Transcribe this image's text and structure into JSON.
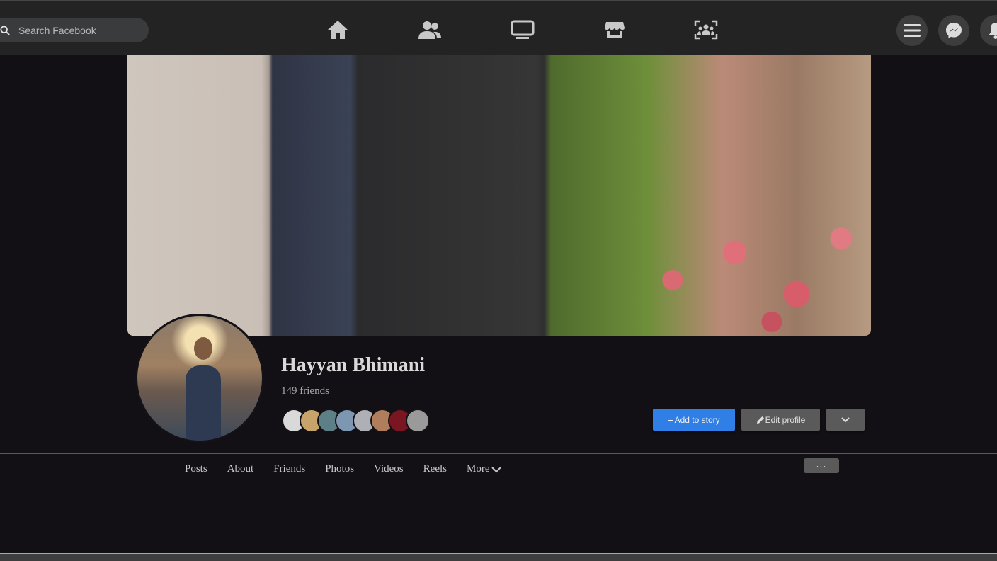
{
  "search": {
    "placeholder": "Search Facebook"
  },
  "nav": {
    "icons": [
      "home-icon",
      "friends-icon",
      "watch-icon",
      "marketplace-icon",
      "groups-icon"
    ],
    "right_buttons": [
      "menu-icon",
      "messenger-icon",
      "notifications-icon"
    ]
  },
  "profile": {
    "name": "Hayyan Bhimani",
    "friends_count": "149 friends"
  },
  "actions": {
    "add_story": "Add to story",
    "edit_profile": "Edit profile"
  },
  "tabs": [
    "Posts",
    "About",
    "Friends",
    "Photos",
    "Videos",
    "Reels",
    "More"
  ],
  "more_options": "···",
  "colors": {
    "accent": "#2f7fe6",
    "background": "#121014",
    "nav": "#232323"
  }
}
